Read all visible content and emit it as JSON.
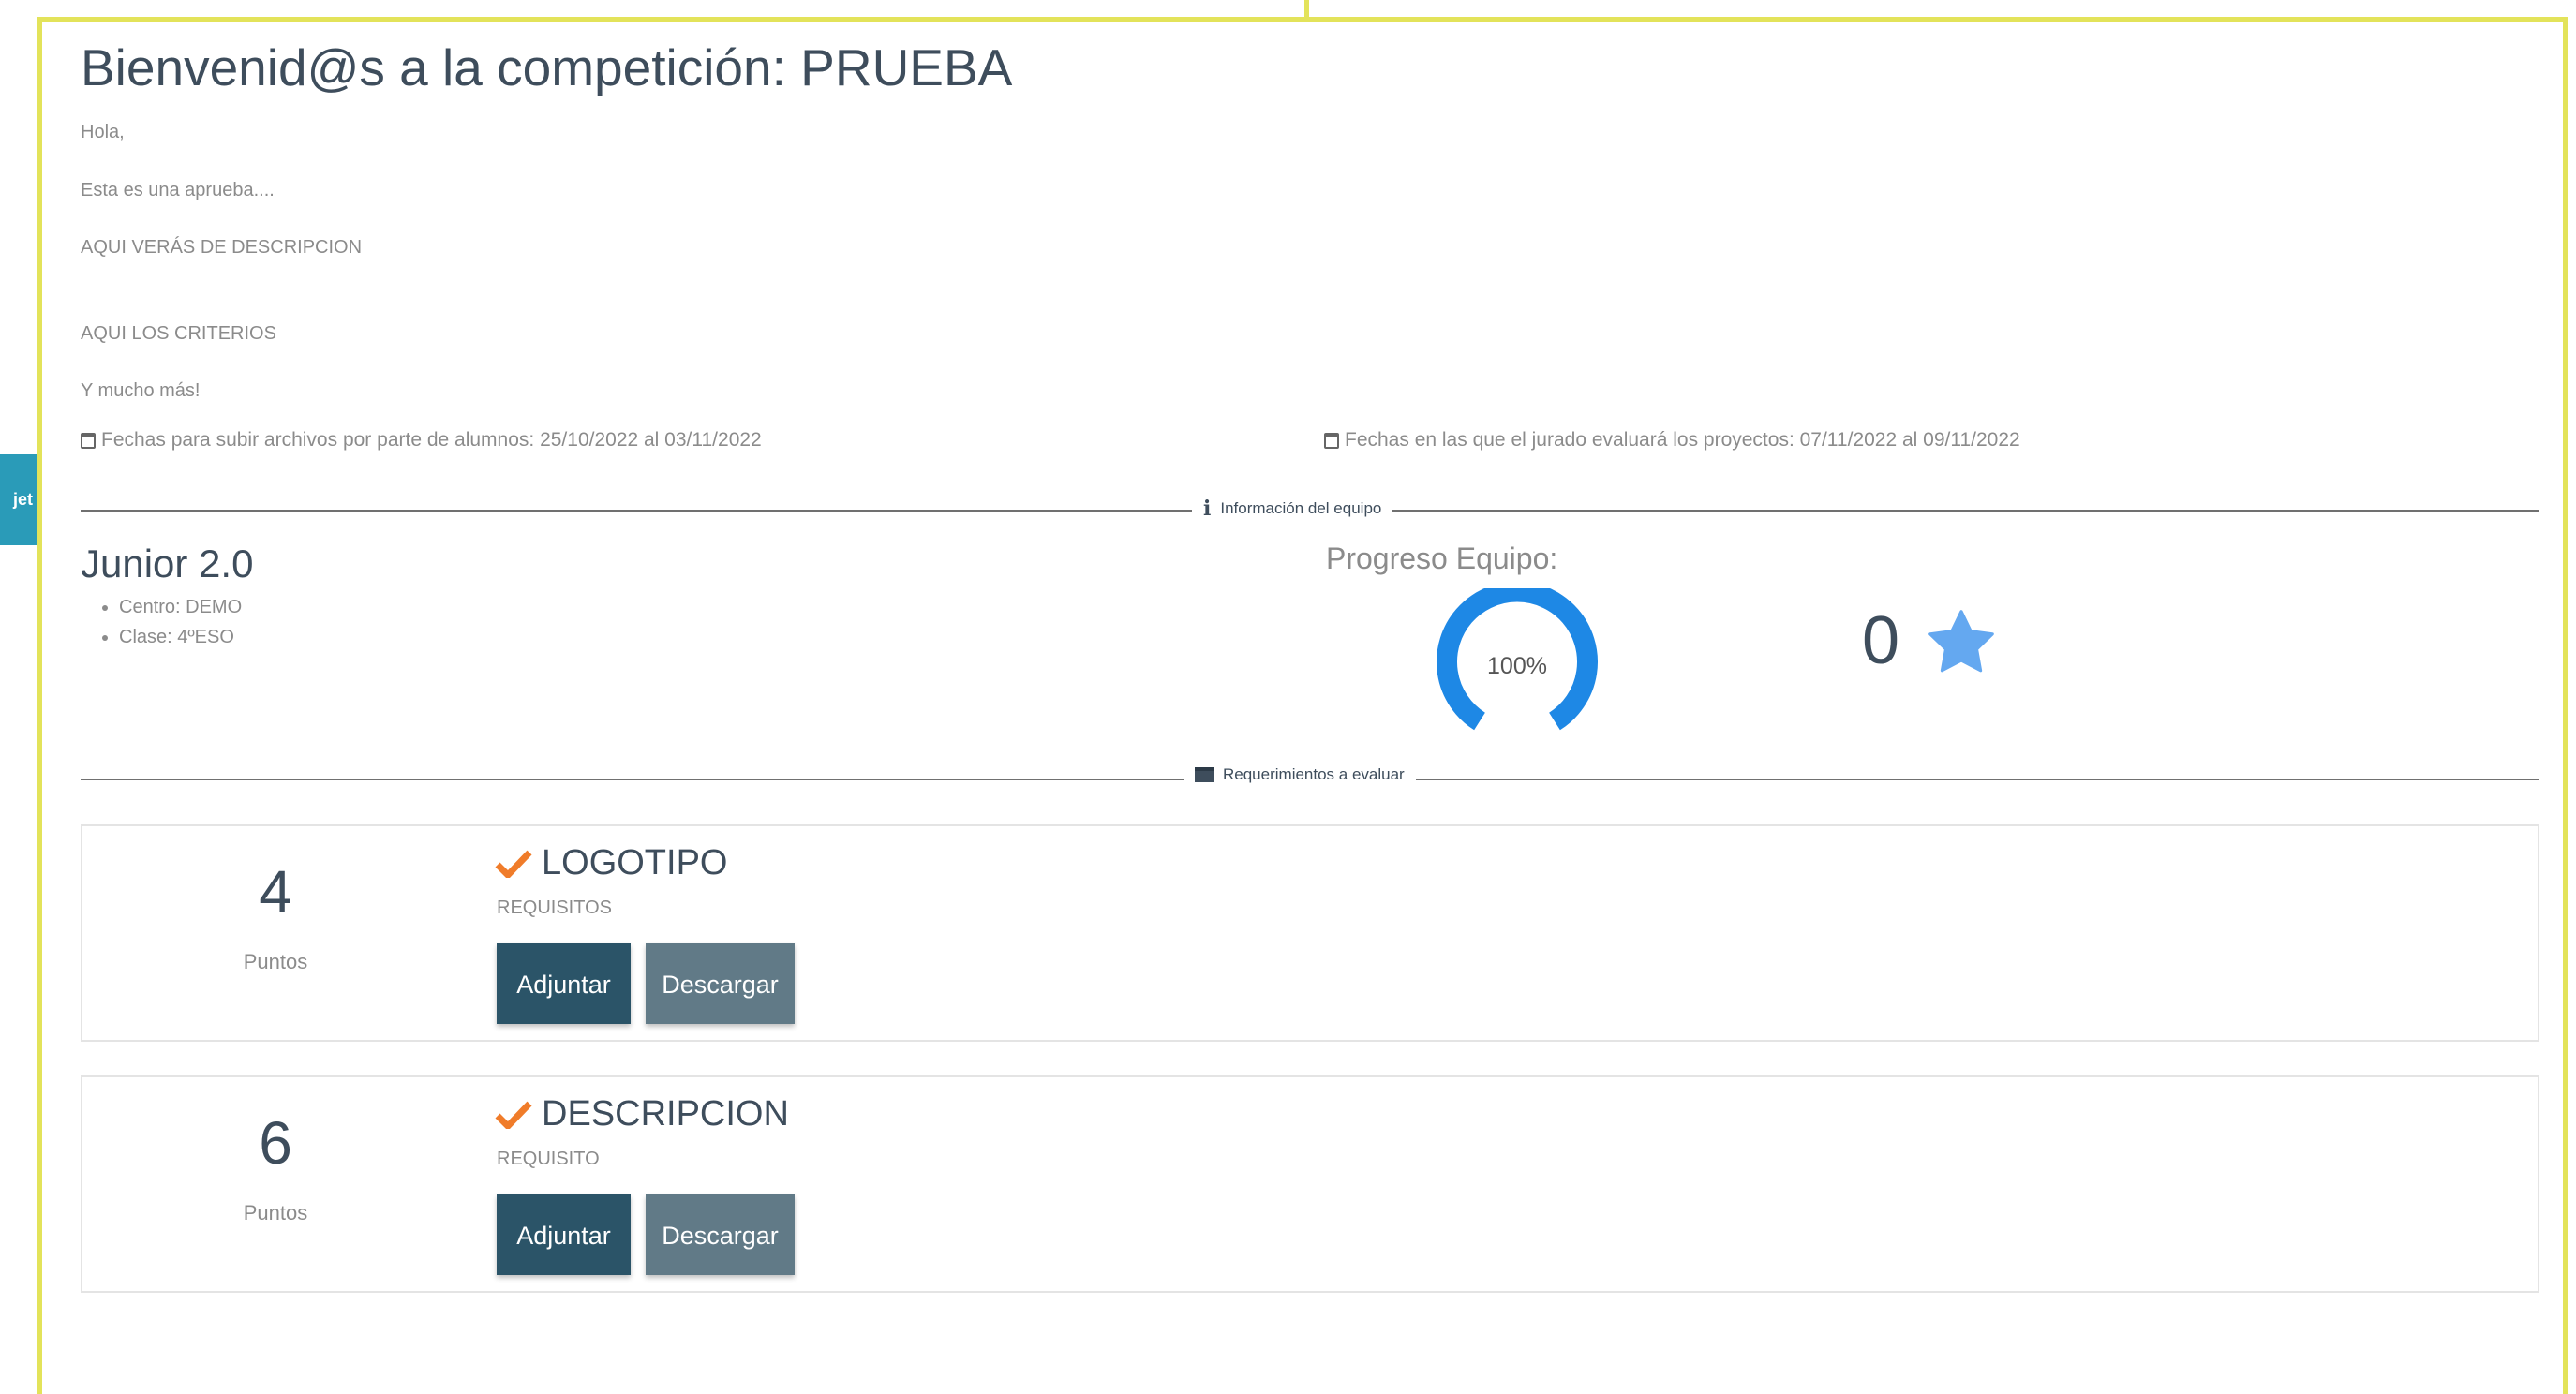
{
  "side_tab": {
    "label": "jet"
  },
  "header": {
    "title": "Bienvenid@s a la competición: PRUEBA"
  },
  "description": {
    "lines": [
      "Hola,",
      "Esta es una aprueba....",
      "AQUI VERÁS DE DESCRIPCION",
      "AQUI LOS CRITERIOS",
      "Y mucho más!"
    ]
  },
  "dates": {
    "upload": "Fechas para subir archivos por parte de alumnos: 25/10/2022 al 03/11/2022",
    "jury": "Fechas en las que el jurado evaluará los proyectos: 07/11/2022 al 09/11/2022"
  },
  "team_section": {
    "divider_label": "Información del equipo",
    "team_name": "Junior 2.0",
    "details": [
      "Centro: DEMO",
      "Clase: 4ºESO"
    ],
    "progress_label": "Progreso Equipo:",
    "progress_text": "100%",
    "progress_value": 100,
    "stars_count": "0"
  },
  "requirements_section": {
    "divider_label": "Requerimientos a evaluar",
    "items": [
      {
        "points": "4",
        "points_label": "Puntos",
        "title": "LOGOTIPO",
        "subtitle": "REQUISITOS",
        "attach_label": "Adjuntar",
        "download_label": "Descargar"
      },
      {
        "points": "6",
        "points_label": "Puntos",
        "title": "DESCRIPCION",
        "subtitle": "REQUISITO",
        "attach_label": "Adjuntar",
        "download_label": "Descargar"
      }
    ]
  },
  "colors": {
    "accent_border": "#e3e35a",
    "gauge": "#1e88e5",
    "star": "#64a8f0",
    "check": "#f07c2a",
    "attach_button": "#2b5468",
    "download_button": "#617a87"
  }
}
